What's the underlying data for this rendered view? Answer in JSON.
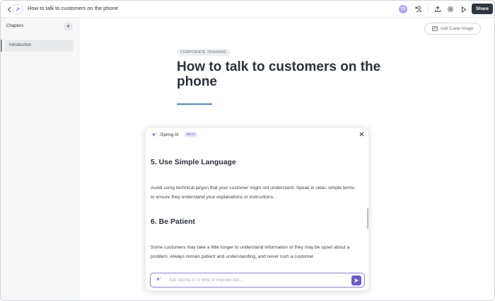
{
  "topbar": {
    "document_title": "How to talk to customers on the phone",
    "avatar_initials": "TO",
    "share_label": "Share"
  },
  "sidebar": {
    "title": "Chapters",
    "add_symbol": "+",
    "items": [
      {
        "label": "Introduction"
      }
    ]
  },
  "main": {
    "cover_button_label": "Add Cover Image",
    "tag": "CORPORATE TRAINING",
    "title": "How to talk to customers on the phone"
  },
  "ai_panel": {
    "title": "iSpring AI",
    "badge": "BETA",
    "sections": [
      {
        "heading": "5. Use Simple Language",
        "body": "Avoid using technical jargon that your customer might not understand. Speak in clear, simple terms to ensure they understand your explanations or instructions."
      },
      {
        "heading": "6. Be Patient",
        "body": "Some customers may take a little longer to understand information or they may be upset about a problem. Always remain patient and understanding, and never rush a customer."
      }
    ],
    "input_placeholder": "Ask iSpring AI to write or improve text...",
    "input_value": ""
  },
  "colors": {
    "accent_purple": "#6e58d8",
    "title_rule_blue": "#4a86d8",
    "share_button": "#2f3740",
    "avatar": "#b7a4ee"
  },
  "icons": {
    "back": "chevron-left-icon",
    "logo": "app-logo-icon",
    "add_user": "add-user-icon",
    "export": "upload-icon",
    "settings": "gear-icon",
    "preview": "play-icon",
    "cover_image": "image-icon",
    "ai": "sparkle-icon",
    "close": "close-icon",
    "send": "send-icon"
  }
}
